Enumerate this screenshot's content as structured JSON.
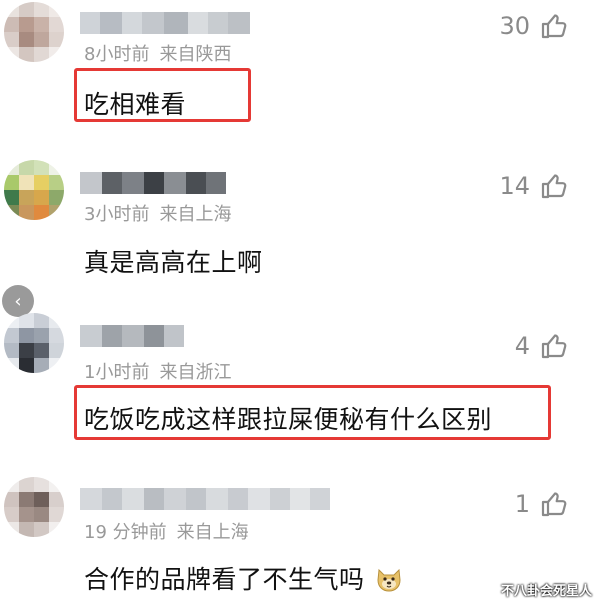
{
  "comments": [
    {
      "time": "8小时前",
      "location": "来自陕西",
      "text": "吃相难看",
      "likes": "30",
      "highlighted": true
    },
    {
      "time": "3小时前",
      "location": "来自上海",
      "text": "真是高高在上啊",
      "likes": "14",
      "highlighted": false
    },
    {
      "time": "1小时前",
      "location": "来自浙江",
      "text": "吃饭吃成这样跟拉屎便秘有什么区别",
      "likes": "4",
      "highlighted": true
    },
    {
      "time": "19 分钟前",
      "location": "来自上海",
      "text": "合作的品牌看了不生气吗",
      "likes": "1",
      "highlighted": false
    }
  ],
  "back_button": "‹",
  "watermark": "不八卦会死星人",
  "colors": {
    "highlight": "#e53935",
    "meta": "#999999",
    "like": "#8a8a8a"
  }
}
